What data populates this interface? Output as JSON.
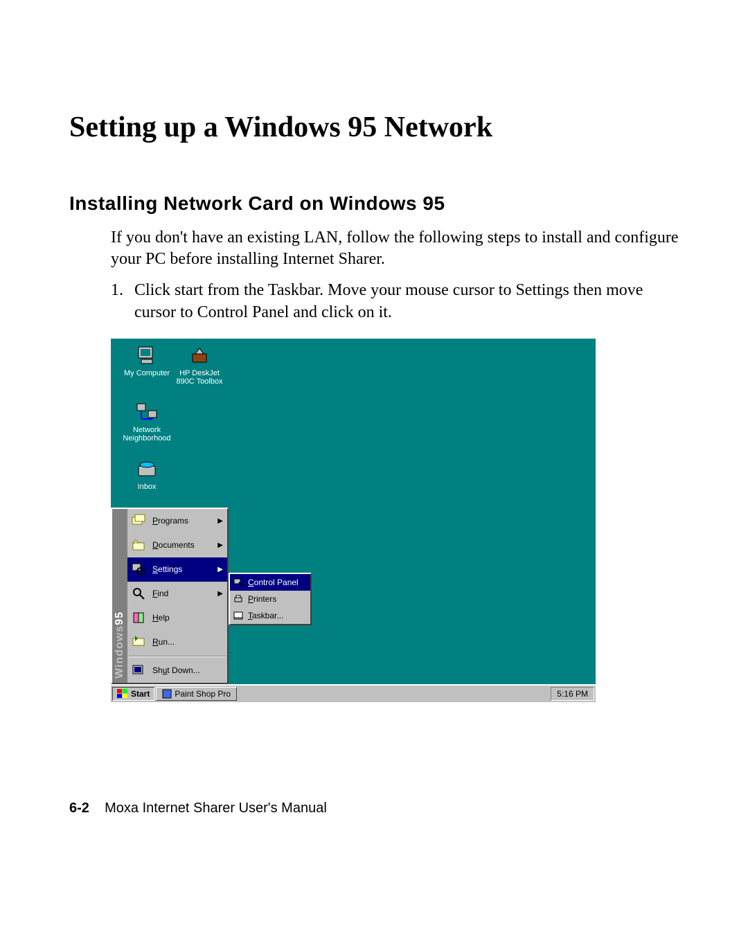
{
  "title": "Setting up a Windows 95 Network",
  "subheading": "Installing Network Card on Windows 95",
  "intro": "If you don't have an existing LAN, follow the following steps to install and configure your PC before installing Internet Sharer.",
  "step_num": "1.",
  "step_text": "Click start from the Taskbar. Move your mouse cursor to Settings then move cursor to Control Panel and click on it.",
  "desktop_icons": {
    "my_computer": "My Computer",
    "hp_deskjet": "HP DeskJet 890C Toolbox",
    "network_neighborhood": "Network Neighborhood",
    "inbox": "Inbox"
  },
  "sidebar_brand_a": "Windows",
  "sidebar_brand_b": "95",
  "start_menu": {
    "programs": "Programs",
    "documents": "Documents",
    "settings": "Settings",
    "find": "Find",
    "help": "Help",
    "run": "Run...",
    "shutdown": "Shut Down..."
  },
  "submenu": {
    "control_panel": "Control Panel",
    "printers": "Printers",
    "taskbar": "Taskbar..."
  },
  "taskbar": {
    "start": "Start",
    "app": "Paint Shop Pro",
    "clock": "5:16 PM"
  },
  "footer_page": "6-2",
  "footer_text": "Moxa Internet Sharer User's Manual",
  "underline_chars": {
    "programs": "P",
    "documents": "D",
    "settings": "S",
    "find": "F",
    "help": "H",
    "run": "R",
    "shutdown": "u",
    "control_panel": "C",
    "printers": "P",
    "taskbar": "T"
  }
}
